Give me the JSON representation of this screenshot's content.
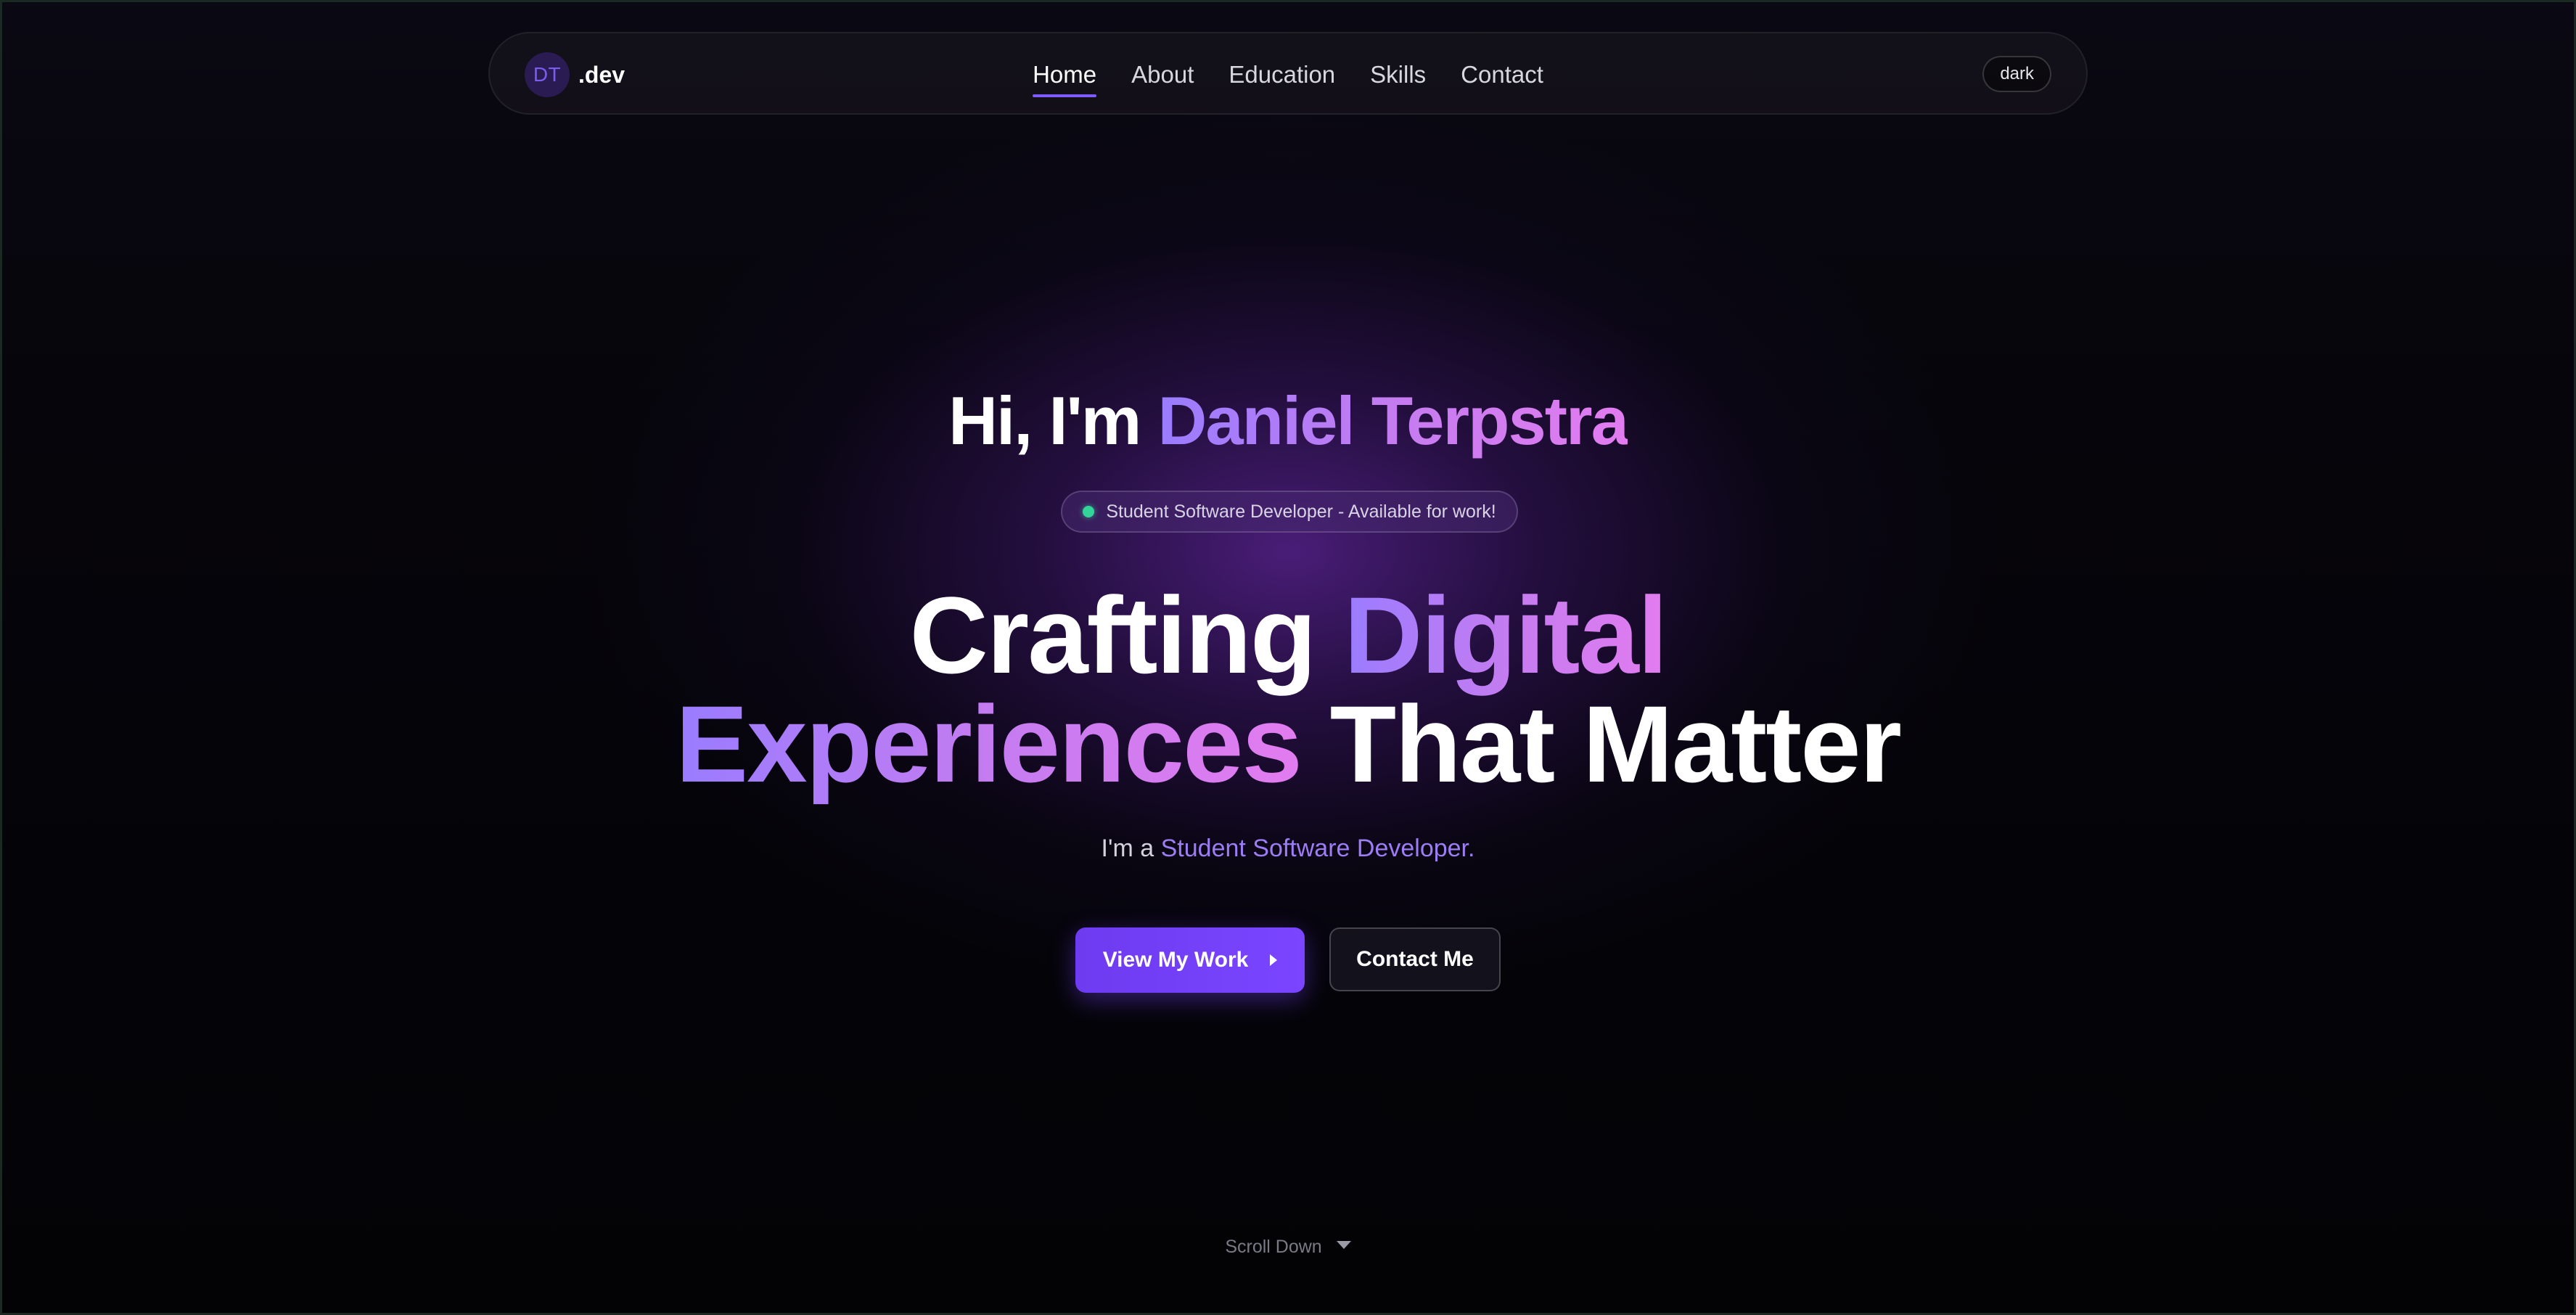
{
  "nav": {
    "logo_initials": "DT",
    "logo_suffix": ".dev",
    "links": [
      {
        "label": "Home",
        "active": true
      },
      {
        "label": "About",
        "active": false
      },
      {
        "label": "Education",
        "active": false
      },
      {
        "label": "Skills",
        "active": false
      },
      {
        "label": "Contact",
        "active": false
      }
    ],
    "theme_toggle": "dark"
  },
  "hero": {
    "greeting_prefix": "Hi, I'm",
    "name": "Daniel Terpstra",
    "status_text": "Student Software Developer - Available for work!",
    "status_color": "#34d399",
    "headline": {
      "part1": "Crafting",
      "part2": "Digital",
      "part3": "Experiences",
      "part4": "That Matter"
    },
    "subtitle_prefix": "I'm a",
    "subtitle_role": "Student Software Developer.",
    "primary_button": "View My Work",
    "secondary_button": "Contact Me",
    "scroll_label": "Scroll Down"
  },
  "colors": {
    "accent": "#7c5cff",
    "gradient_start": "#9a7cff",
    "gradient_end": "#e27cf0",
    "background": "#030306"
  }
}
